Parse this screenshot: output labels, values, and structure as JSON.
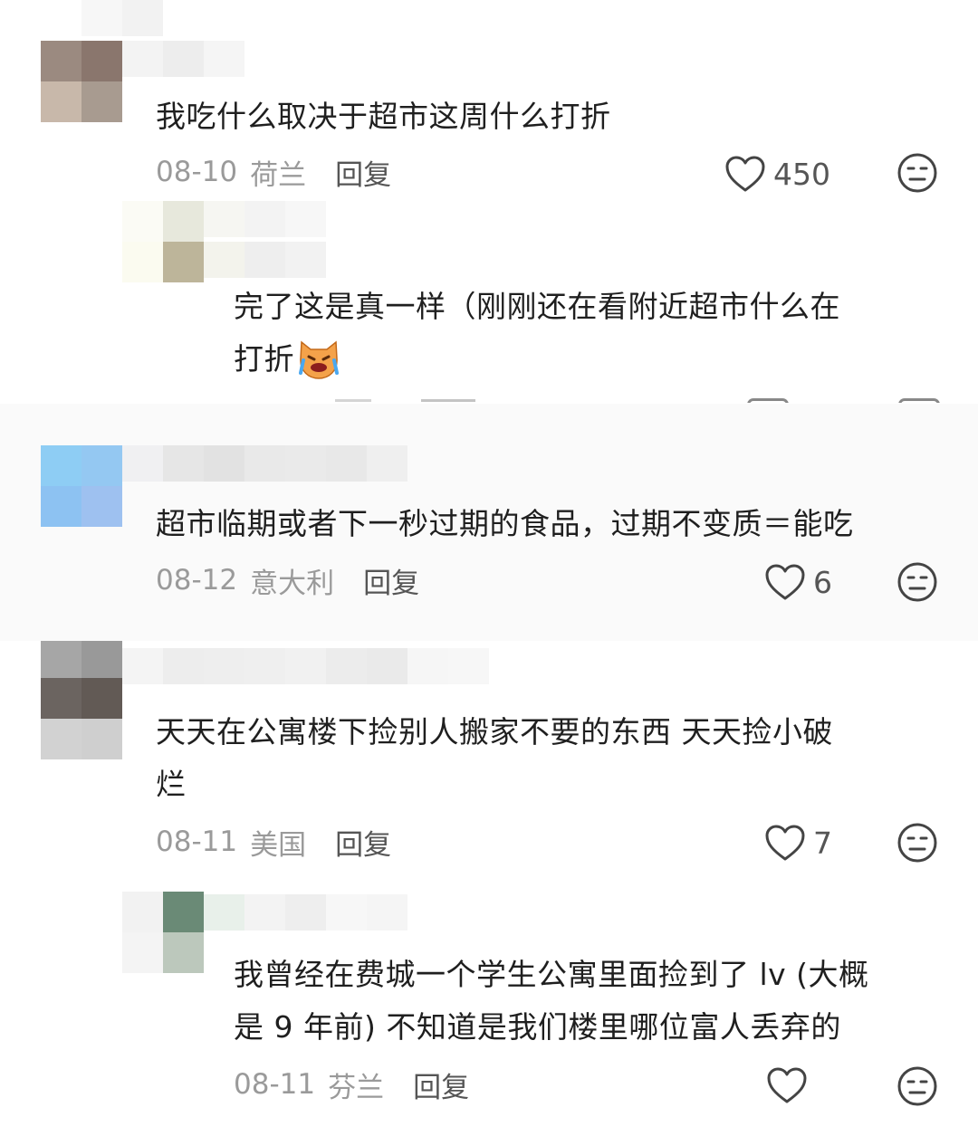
{
  "comments": [
    {
      "text": "我吃什么取决于超市这周什么打折",
      "date": "08-10",
      "location": "荷兰",
      "reply_label": "回复",
      "likes": "450",
      "replies": [
        {
          "text_line1": "完了这是真一样（刚刚还在看附近超市什么在",
          "text_line2": "打折",
          "emoji_icon": "crying-cat-emoji"
        }
      ]
    },
    {
      "text": "超市临期或者下一秒过期的食品，过期不变质＝能吃",
      "date": "08-12",
      "location": "意大利",
      "reply_label": "回复",
      "likes": "6"
    },
    {
      "text_line1": "天天在公寓楼下捡别人搬家不要的东西 天天捡小破",
      "text_line2": "烂",
      "date": "08-11",
      "location": "美国",
      "reply_label": "回复",
      "likes": "7",
      "replies": [
        {
          "text_line1": "我曾经在费城一个学生公寓里面捡到了 lv (大概",
          "text_line2": "是 9 年前) 不知道是我们楼里哪位富人丢弃的",
          "date": "08-11",
          "location": "芬兰",
          "reply_label": "回复"
        }
      ]
    }
  ],
  "icons": {
    "like": "heart-outline-icon",
    "dislike": "neutral-face-icon"
  },
  "colors": {
    "text": "#1f1f1f",
    "meta": "#9a9a9a",
    "icon": "#444444"
  }
}
